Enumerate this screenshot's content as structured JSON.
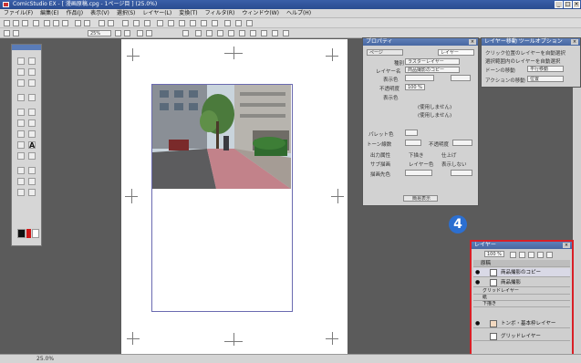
{
  "window": {
    "title": "ComicStudio EX - [ 漫画原稿.cpg - 1ページ目 ] (25.0%)"
  },
  "menu": [
    "ファイル(F)",
    "編集(E)",
    "作品(J)",
    "表示(V)",
    "選択(S)",
    "レイヤー(L)",
    "変換(T)",
    "フィルタ(R)",
    "ウィンドウ(W)",
    "ヘルプ(H)"
  ],
  "toolbar": {
    "zoom_value": "25%"
  },
  "properties": {
    "title": "プロパティ",
    "tabs": [
      "ページ",
      "レイヤー"
    ],
    "type_label": "種別",
    "type_value": "ラスターレイヤー",
    "name_label": "レイヤー名",
    "name_value": "商品撮影のコピー",
    "color_label": "表示色",
    "opacity_label": "不透明度",
    "opacity_value": "100 %",
    "blend_label": "表示色",
    "unused1": "(使用しません)",
    "unused2": "(使用しません)",
    "palette_label": "パレット色",
    "tone_label": "トーン線数",
    "tone_angle": "不透明度",
    "output_label": "出力属性",
    "output_opt1": "下描き",
    "output_opt2": "仕上げ",
    "sub_label": "サブ描画",
    "sub_opt1": "レイヤー色",
    "sub_opt2": "表示しない",
    "draw_label": "描画先色",
    "apply_button": "簡易表示"
  },
  "move_panel": {
    "title": "レイヤー移動 ツールオプション",
    "opt1": "クリック位置のレイヤーを自動選択",
    "opt2": "選択範囲内のレイヤーを自動選択",
    "mode_label": "ドーンの移動",
    "mode_value": "平行移動",
    "action_label": "アクションの移動",
    "action_value": "位置"
  },
  "layers_panel": {
    "title": "レイヤー",
    "opacity": "100 %",
    "group": "原稿",
    "items": [
      {
        "name": "商品撮影のコピー",
        "selected": true
      },
      {
        "name": "商品撮影",
        "selected": false
      },
      {
        "name": "グリッドレイヤー",
        "selected": false
      },
      {
        "name": "紙",
        "selected": false
      },
      {
        "name": "下描き",
        "selected": false
      },
      {
        "name": "トンボ・基本枠レイヤー",
        "selected": false
      },
      {
        "name": "グリッドレイヤー",
        "selected": false
      }
    ]
  },
  "annotation": {
    "step": "4"
  },
  "status": {
    "text": "25.0%"
  },
  "colors": {
    "accent": "#d91f26",
    "title": "#3a5fa8",
    "badge": "#2c6fd0"
  }
}
